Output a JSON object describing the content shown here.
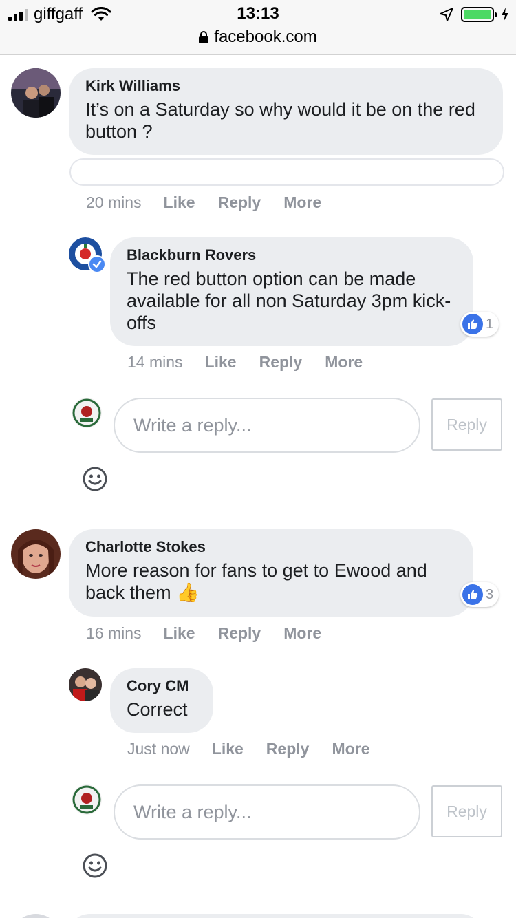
{
  "status_bar": {
    "carrier": "giffgaff",
    "time": "13:13",
    "url": "facebook.com"
  },
  "comments": [
    {
      "author": "Kirk Williams",
      "text": "It’s on a Saturday so why would it be on the red button ?",
      "time": "20 mins",
      "like": "Like",
      "reply": "Reply",
      "more": "More"
    },
    {
      "author": "Blackburn Rovers",
      "text": "The red button option can be made available for all non Saturday 3pm kick-offs",
      "time": "14 mins",
      "like": "Like",
      "reply": "Reply",
      "more": "More",
      "reactions": "1"
    },
    {
      "author": "Charlotte Stokes",
      "text": "More reason for fans to get to Ewood and back them",
      "emoji": "👍",
      "time": "16 mins",
      "like": "Like",
      "reply": "Reply",
      "more": "More",
      "reactions": "3"
    },
    {
      "author": "Cory CM",
      "text": "Correct",
      "time": "Just now",
      "like": "Like",
      "reply": "Reply",
      "more": "More"
    }
  ],
  "reply_box": {
    "placeholder": "Write a reply...",
    "button": "Reply"
  },
  "colors": {
    "bubble": "#ebedf0",
    "like_blue": "#3b73e8",
    "muted": "#90949c"
  }
}
